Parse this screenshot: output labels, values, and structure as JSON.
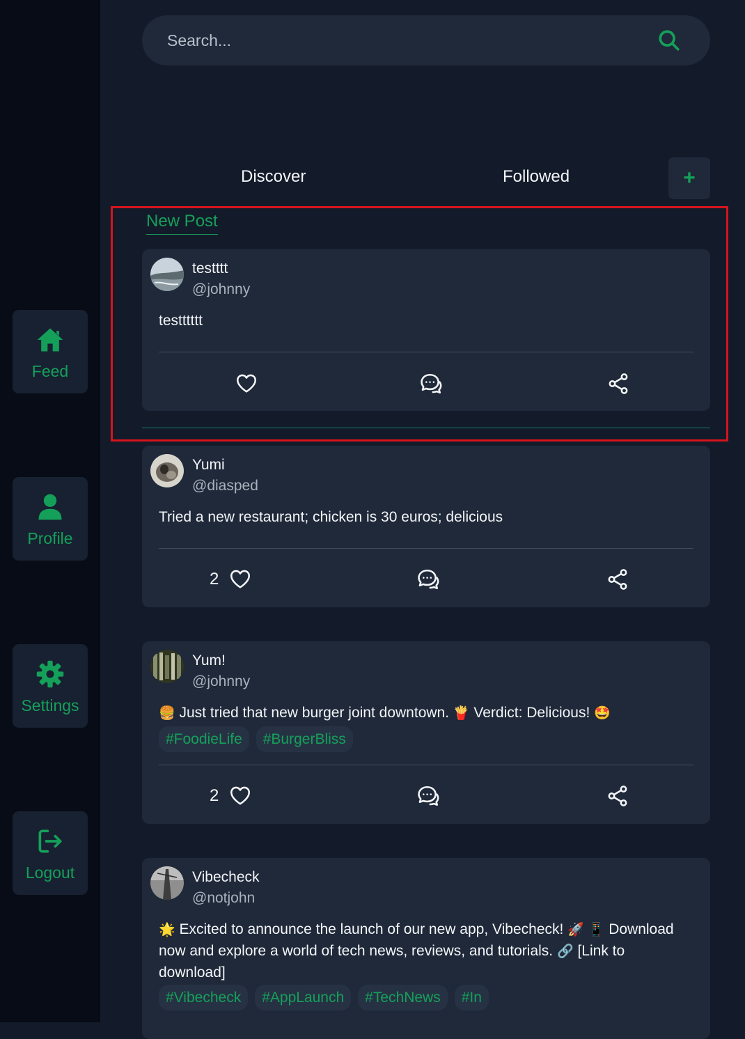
{
  "sidebar": {
    "items": [
      {
        "label": "Feed",
        "icon": "home-icon"
      },
      {
        "label": "Profile",
        "icon": "user-icon"
      },
      {
        "label": "Settings",
        "icon": "gear-icon"
      },
      {
        "label": "Logout",
        "icon": "logout-icon"
      }
    ]
  },
  "search": {
    "placeholder": "Search...",
    "value": ""
  },
  "tabs": {
    "discover": "Discover",
    "followed": "Followed",
    "add": "+"
  },
  "new_post_label": "New Post",
  "colors": {
    "accent": "#15a05a",
    "background": "#131b2a",
    "card": "#1f2939",
    "sidebar": "#080c16",
    "highlight": "#d7131c"
  },
  "posts": [
    {
      "name": "testttt",
      "handle": "@johnny",
      "text": "testttttt",
      "tags": [],
      "likes": ""
    },
    {
      "name": "Yumi",
      "handle": "@diasped",
      "text": "Tried a new restaurant; chicken is 30 euros; delicious",
      "tags": [],
      "likes": "2"
    },
    {
      "name": "Yum!",
      "handle": "@johnny",
      "text_parts": [
        "🍔",
        " Just tried that new burger joint downtown. ",
        "🍟",
        " Verdict: Delicious! ",
        "🤩"
      ],
      "tags": [
        "#FoodieLife",
        "#BurgerBliss"
      ],
      "likes": "2"
    },
    {
      "name": "Vibecheck",
      "handle": "@notjohn",
      "text_parts": [
        "🌟",
        " Excited to announce the launch of our new app, Vibecheck! ",
        "🚀",
        " ",
        "📱",
        " Download now and explore a world of tech news, reviews, and tutorials. ",
        "🔗",
        " [Link to download]"
      ],
      "tags": [
        "#Vibecheck",
        "#AppLaunch",
        "#TechNews",
        "#In"
      ],
      "likes": ""
    }
  ]
}
